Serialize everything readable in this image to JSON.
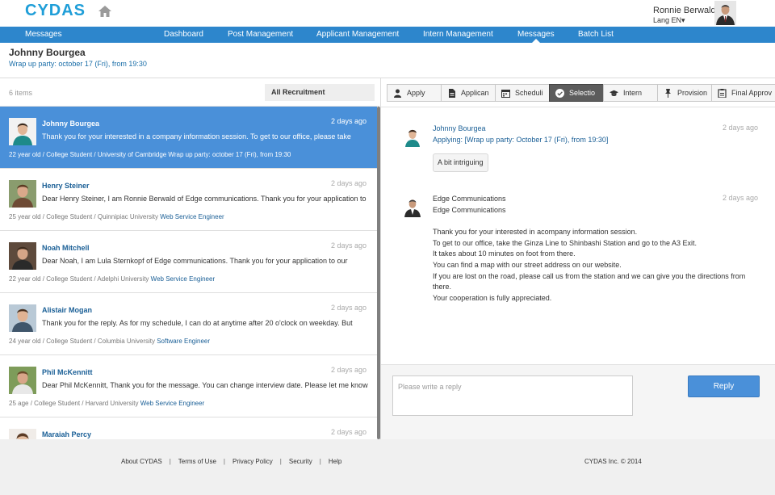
{
  "header": {
    "logo": "CYDAS",
    "user_name": "Ronnie Berwald",
    "lang": "Lang EN▾"
  },
  "nav": {
    "section_label": "Messages",
    "items": [
      "Dashboard",
      "Post Management",
      "Applicant Management",
      "Intern Management",
      "Messages",
      "Batch List"
    ],
    "active": "Messages"
  },
  "page": {
    "title": "Johnny Bourgea",
    "subtitle": "Wrap up party: october 17 (Fri), from 19:30"
  },
  "list": {
    "count": "6 items",
    "filter": "All Recruitment",
    "items": [
      {
        "name": "Johnny Bourgea",
        "time": "2 days ago",
        "message": "Thank you for your interested in a company information session. To get to our office, please take",
        "meta": "22 year old / College Student / University of Cambridge Wrap up party: october 17 (Fri), from 19:30",
        "job": ""
      },
      {
        "name": "Henry Steiner",
        "time": "2 days ago",
        "message": "Dear Henry Steiner, I am Ronnie Berwald of Edge communications. Thank you for your application to",
        "meta": "25 year old / College Student / Quinnipiac University",
        "job": "Web Service Engineer"
      },
      {
        "name": "Noah Mitchell",
        "time": "2 days ago",
        "message": "Dear Noah, I am Lula Sternkopf of Edge communications. Thank you for your application to our",
        "meta": "22 year old / College Student / Adelphi University",
        "job": "Web Service Engineer"
      },
      {
        "name": "Alistair Mogan",
        "time": "2 days ago",
        "message": "Thank you for the reply. As for my schedule, I can do at anytime after 20 o'clock on weekday. But",
        "meta": "24 year old / College Student / Columbia University",
        "job": "Software Engineer"
      },
      {
        "name": "Phil McKennitt",
        "time": "2 days ago",
        "message": "Dear Phil McKennitt, Thank you for the message. You can change interview date. Please let me know",
        "meta": "25 age / College Student / Harvard University",
        "job": "Web Service Engineer"
      },
      {
        "name": "Maraiah Percy",
        "time": "2 days ago",
        "message": "",
        "meta": "",
        "job": ""
      }
    ]
  },
  "tabs": [
    "Apply",
    "Applican",
    "Scheduli",
    "Selectio",
    "Intern",
    "Provision",
    "Final Approv"
  ],
  "active_tab": "Selectio",
  "thread": {
    "msg1": {
      "name": "Johnny Bourgea",
      "time": "2 days ago",
      "applying": "Applying: [Wrap up party: October 17 (Fri), from 19:30]",
      "reply": "A bit intriguing"
    },
    "msg2": {
      "name": "Edge Communications",
      "time": "2 days ago",
      "lines": [
        "Edge Communications",
        "",
        "Thank you for your interested in acompany information session.",
        "To get to our office, take the Ginza Line to Shinbashi Station and go to the A3 Exit.",
        "It takes about 10 minutes on foot from there.",
        "You can find a map with our street address on our website.",
        "If you are lost on the road, please call us from the station and we can give you the directions from",
        "there.",
        "Your cooperation is fully appreciated."
      ]
    }
  },
  "reply": {
    "placeholder": "Please write a reply",
    "button": "Reply"
  },
  "footer": {
    "links": [
      "About CYDAS",
      "Terms of Use",
      "Privacy Policy",
      "Security",
      "Help"
    ],
    "copyright": "CYDAS Inc. © 2014"
  },
  "colors": {
    "brand": "#1f9ed8",
    "nav": "#2d86cc",
    "selected": "#4a90d9",
    "link": "#1a5f96"
  }
}
